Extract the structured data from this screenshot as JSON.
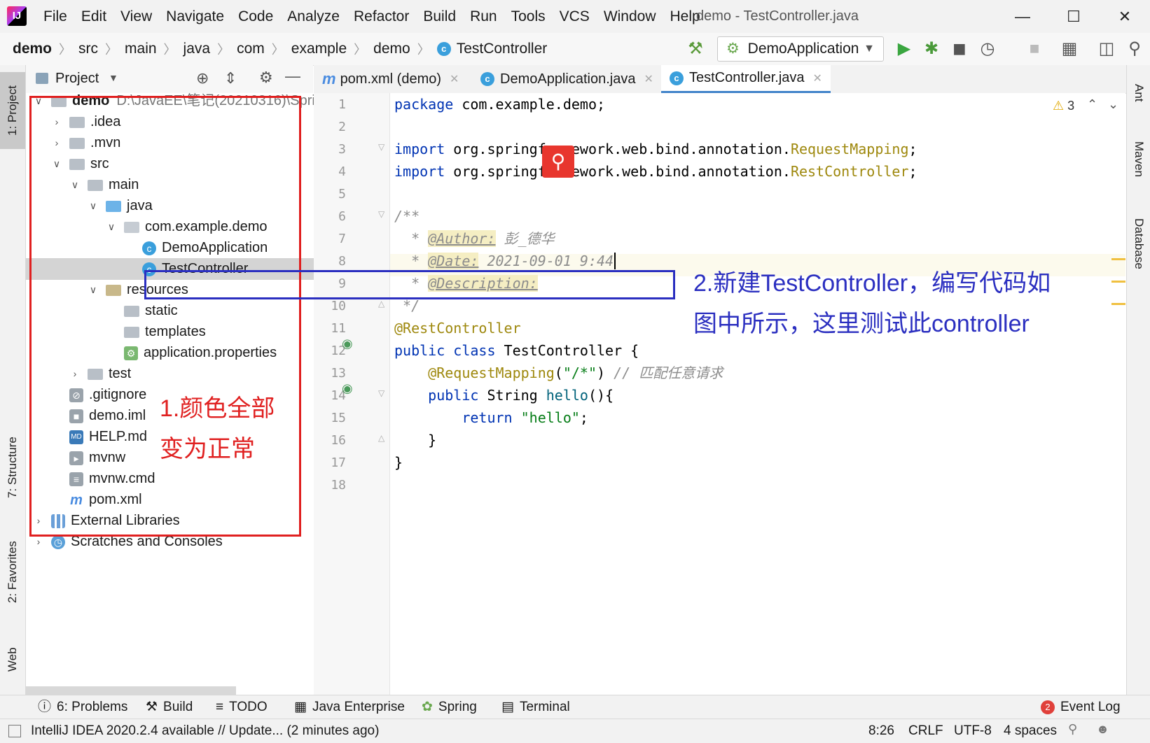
{
  "menubar": {
    "logo": "IJ",
    "items": [
      "File",
      "Edit",
      "View",
      "Navigate",
      "Code",
      "Analyze",
      "Refactor",
      "Build",
      "Run",
      "Tools",
      "VCS",
      "Window",
      "Help"
    ],
    "window_title": "demo - TestController.java"
  },
  "navbar": {
    "breadcrumbs": [
      "demo",
      "src",
      "main",
      "java",
      "com",
      "example",
      "demo",
      "TestController"
    ],
    "run_config": "DemoApplication"
  },
  "left_tool_tabs": [
    "1: Project",
    "7: Structure",
    "2: Favorites",
    "Web"
  ],
  "right_tool_tabs": [
    "Ant",
    "Maven",
    "Database"
  ],
  "project_panel": {
    "title": "Project",
    "root_name": "demo",
    "root_path": "D:\\JavaEE\\笔记(20210316)\\Sprir",
    "tree": [
      {
        "label": ".idea"
      },
      {
        "label": ".mvn"
      },
      {
        "label": "src"
      },
      {
        "label": "main"
      },
      {
        "label": "java"
      },
      {
        "label": "com.example.demo"
      },
      {
        "label": "DemoApplication"
      },
      {
        "label": "TestController"
      },
      {
        "label": "resources"
      },
      {
        "label": "static"
      },
      {
        "label": "templates"
      },
      {
        "label": "application.properties"
      },
      {
        "label": "test"
      },
      {
        "label": ".gitignore"
      },
      {
        "label": "demo.iml"
      },
      {
        "label": "HELP.md"
      },
      {
        "label": "mvnw"
      },
      {
        "label": "mvnw.cmd"
      },
      {
        "label": "pom.xml"
      },
      {
        "label": "External Libraries"
      },
      {
        "label": "Scratches and Consoles"
      }
    ]
  },
  "editor": {
    "tabs": [
      {
        "label": "pom.xml (demo)"
      },
      {
        "label": "DemoApplication.java"
      },
      {
        "label": "TestController.java"
      }
    ],
    "warnings": "3",
    "line_numbers": [
      "1",
      "2",
      "3",
      "4",
      "5",
      "6",
      "7",
      "8",
      "9",
      "10",
      "11",
      "12",
      "13",
      "14",
      "15",
      "16",
      "17",
      "18"
    ],
    "code": {
      "l1_kw": "package",
      "l1_rest": " com.example.demo;",
      "l3_kw": "import",
      "l3_rest": " org.springframework.web.bind.annotation.",
      "l3_cls": "RequestMapping",
      "l3_end": ";",
      "l4_kw": "import",
      "l4_rest": " org.springframework.web.bind.annotation.",
      "l4_cls": "RestController",
      "l4_end": ";",
      "l6": "/**",
      "l7_star": "* ",
      "l7_tag": "@Author:",
      "l7_val": " 彭_德华",
      "l8_star": "* ",
      "l8_tag": "@Date:",
      "l8_val": " 2021-09-01 9:44",
      "l9_star": "* ",
      "l9_tag": "@Description:",
      "l10": " */",
      "l11": "@RestController",
      "l12_kw": "public class",
      "l12_rest": " TestController {",
      "l13_ann": "@RequestMapping",
      "l13_p1": "(",
      "l13_str": "\"/*\"",
      "l13_p2": ") ",
      "l13_cmt": "// 匹配任意请求",
      "l14_kw": "public",
      "l14_type": " String ",
      "l14_fn": "hello",
      "l14_rest": "(){",
      "l15_kw": "return",
      "l15_str": " \"hello\"",
      "l15_end": ";",
      "l16": "}",
      "l17": "}"
    }
  },
  "annotations": {
    "red_note_line1": "1.颜色全部",
    "red_note_line2": "变为正常",
    "blue_note_line1": "2.新建TestController，编写代码如",
    "blue_note_line2": "图中所示，这里测试此controller",
    "colors": {
      "red": "#e02020",
      "blue": "#2b2fc0"
    }
  },
  "bottom_tools": [
    "6: Problems",
    "Build",
    "TODO",
    "Java Enterprise",
    "Spring",
    "Terminal",
    "Event Log"
  ],
  "event_log_count": "2",
  "status": {
    "message": "IntelliJ IDEA 2020.2.4 available // Update... (2 minutes ago)",
    "position": "8:26",
    "line_sep": "CRLF",
    "encoding": "UTF-8",
    "indent": "4 spaces"
  }
}
